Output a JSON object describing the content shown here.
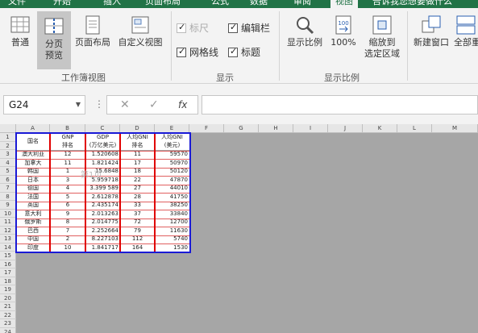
{
  "ribbon_tabs": [
    {
      "label": "文件"
    },
    {
      "label": "开始"
    },
    {
      "label": "插入"
    },
    {
      "label": "页面布局"
    },
    {
      "label": "公式"
    },
    {
      "label": "数据"
    },
    {
      "label": "审阅"
    },
    {
      "label": "视图"
    }
  ],
  "tell_me": "告诉我您想要做什么",
  "workbook_views": {
    "normal": "普通",
    "page_break_line1": "分页",
    "page_break_line2": "预览",
    "page_layout": "页面布局",
    "custom_views": "自定义视图",
    "group_label": "工作簿视图"
  },
  "show": {
    "ruler": "标尺",
    "formula_bar": "编辑栏",
    "gridlines": "网格线",
    "headings": "标题",
    "group_label": "显示"
  },
  "zoom": {
    "zoom": "显示比例",
    "hundred": "100%",
    "zoom_to_selection_line1": "缩放到",
    "zoom_to_selection_line2": "选定区域",
    "group_label": "显示比例"
  },
  "window": {
    "new_window": "新建窗口",
    "arrange_all": "全部重"
  },
  "name_box": "G24",
  "formula_fx": "fx",
  "columns": [
    "A",
    "B",
    "C",
    "D",
    "E",
    "F",
    "G",
    "H",
    "I",
    "J",
    "K",
    "L",
    "M"
  ],
  "rows": [
    "1",
    "2",
    "3",
    "4",
    "5",
    "6",
    "7",
    "8",
    "9",
    "10",
    "11",
    "12",
    "13",
    "14",
    "15",
    "16",
    "17",
    "18",
    "19",
    "20",
    "21",
    "22",
    "23",
    "24"
  ],
  "table": {
    "headers": [
      "国名",
      "GNP排名",
      "GDP(万亿美元)",
      "人均GNI排名",
      "人均GNI(美元)"
    ],
    "header_line1": [
      "国名",
      "GNP",
      "GDP",
      "人均GNI",
      "人均GNI"
    ],
    "header_line2": [
      "",
      "排名",
      "(万亿美元)",
      "排名",
      "(美元)"
    ],
    "data": [
      [
        "澳大利亚",
        "12",
        "1.520608",
        "11",
        "59570"
      ],
      [
        "加拿大",
        "11",
        "1.821424",
        "17",
        "50970"
      ],
      [
        "韩国",
        "1",
        "15.6848",
        "18",
        "50120"
      ],
      [
        "日本",
        "3",
        "5.959718",
        "22",
        "47870"
      ],
      [
        "德国",
        "4",
        "3.399 589",
        "27",
        "44010"
      ],
      [
        "法国",
        "5",
        "2.612878",
        "28",
        "41750"
      ],
      [
        "英国",
        "6",
        "2.435174",
        "33",
        "38250"
      ],
      [
        "意大利",
        "9",
        "2.013263",
        "37",
        "33840"
      ],
      [
        "俄罗斯",
        "8",
        "2.014775",
        "72",
        "12700"
      ],
      [
        "巴西",
        "7",
        "2.252664",
        "79",
        "11630"
      ],
      [
        "中国",
        "2",
        "8.227103",
        "112",
        "5740"
      ],
      [
        "印度",
        "10",
        "1.841717",
        "164",
        "1530"
      ]
    ]
  },
  "watermark": "第1页",
  "colors": {
    "accent": "#217346",
    "page_break_line": "#e00000",
    "print_area_border": "#1a1ad6",
    "outside_area": "#a6a6a6"
  }
}
